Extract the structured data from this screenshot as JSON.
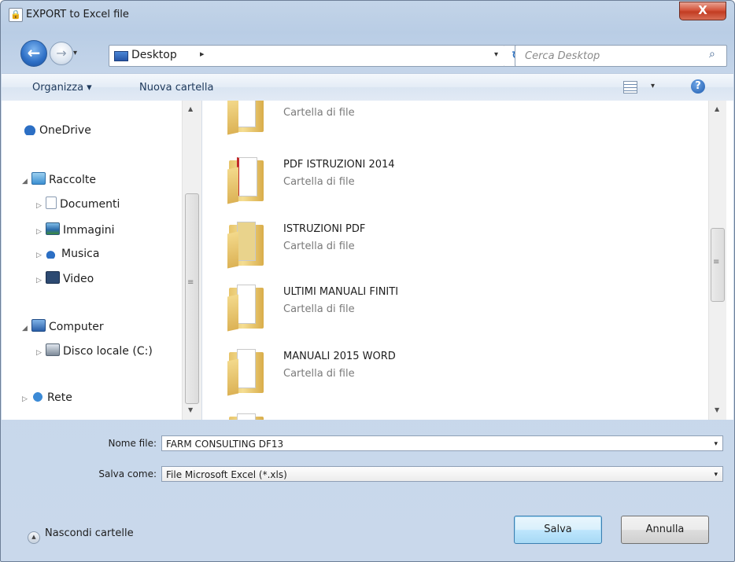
{
  "window": {
    "title": "EXPORT to Excel file",
    "close_glyph": "X"
  },
  "address": {
    "location": "Desktop",
    "separator": "▸",
    "dropdown": "▾",
    "refresh": "↻"
  },
  "search": {
    "placeholder": "Cerca Desktop"
  },
  "toolbar": {
    "organize": "Organizza ▾",
    "new_folder": "Nuova cartella",
    "view_dropdown": "▾",
    "help": "?"
  },
  "nav": {
    "onedrive": "OneDrive",
    "libraries": "Raccolte",
    "documents": "Documenti",
    "images": "Immagini",
    "music": "Musica",
    "video": "Video",
    "computer": "Computer",
    "local_disk": "Disco locale (C:)",
    "network": "Rete",
    "expanded_tri": "◢",
    "collapsed_tri": "▷"
  },
  "files": [
    {
      "name": "",
      "type": "Cartella di file"
    },
    {
      "name": "PDF ISTRUZIONI 2014",
      "type": "Cartella di file"
    },
    {
      "name": "ISTRUZIONI PDF",
      "type": "Cartella di file"
    },
    {
      "name": "ULTIMI MANUALI FINITI",
      "type": "Cartella di file"
    },
    {
      "name": "MANUALI 2015 WORD",
      "type": "Cartella di file"
    }
  ],
  "form": {
    "filename_label": "Nome file:",
    "filename_value": "FARM CONSULTING DF13",
    "savetype_label": "Salva come:",
    "savetype_value": "File Microsoft Excel (*.xls)",
    "dropdown": "▾"
  },
  "footer": {
    "hide_folders": "Nascondi cartelle",
    "save": "Salva",
    "cancel": "Annulla"
  },
  "colors": {
    "frame": "#c3d4e8",
    "accent": "#2d6fc6",
    "close": "#c23c22"
  },
  "icons": [
    "lock-icon",
    "back-arrow-icon",
    "forward-arrow-icon",
    "desktop-icon",
    "refresh-icon",
    "search-icon",
    "view-options-icon",
    "help-icon",
    "folder-icon",
    "cloud-icon",
    "library-icon",
    "computer-icon",
    "disk-icon",
    "network-icon"
  ]
}
